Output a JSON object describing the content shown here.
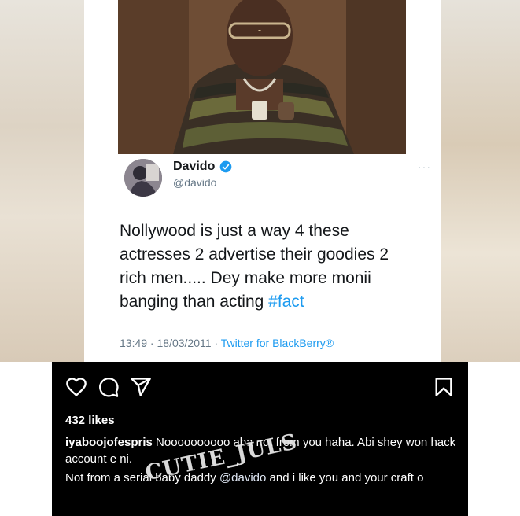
{
  "tweet": {
    "display_name": "Davido",
    "handle": "@davido",
    "verified": true,
    "text_lines": [
      "Nollywood is just a way 4 these",
      "actresses 2 advertise their goodies 2",
      "rich men..... Dey make more monii",
      "banging than acting "
    ],
    "hashtag": "#fact",
    "time": "13:49",
    "date": "18/03/2011",
    "separator": " · ",
    "source": "Twitter for BlackBerry®",
    "more_icon": "···"
  },
  "post": {
    "likes": "432 likes",
    "caption_user": "iyaboojofespris",
    "caption_text": " Noooooooooo aba not from you haha. Abi shey won hack account e ni.",
    "comment_before": "Not from a serial baby daddy ",
    "comment_mention": "@davido",
    "comment_after": " and i like you and your craft o"
  },
  "watermark": "CUTIE_JULS",
  "icons": {
    "like": "heart-icon",
    "comment": "comment-icon",
    "share": "share-icon",
    "save": "bookmark-icon",
    "verified": "verified-badge-icon"
  },
  "colors": {
    "hashtag": "#1d9bf0",
    "verified": "#1d9bf0",
    "panel": "#000000"
  }
}
